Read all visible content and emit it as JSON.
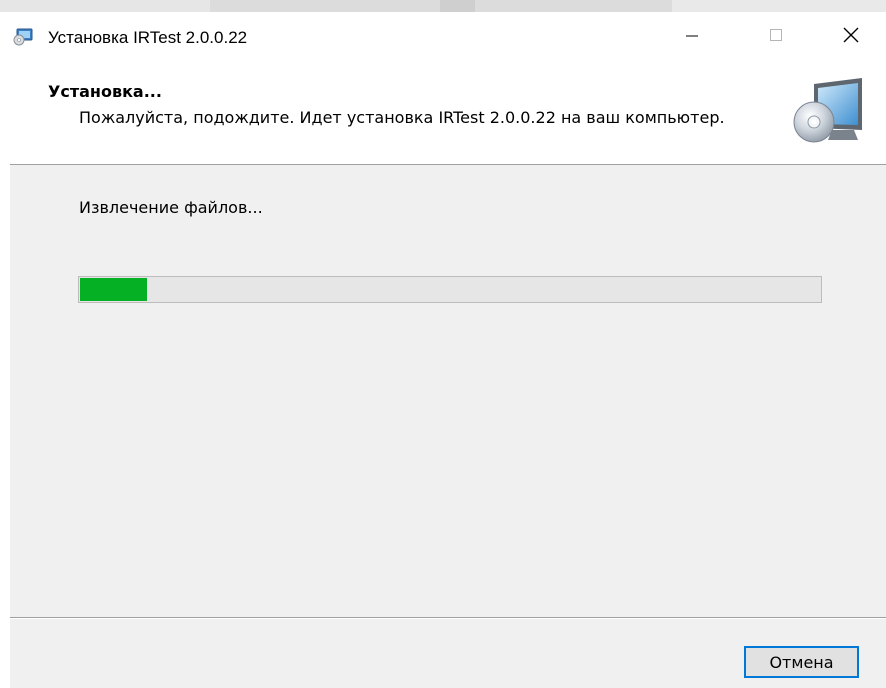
{
  "window": {
    "title": "Установка IRTest 2.0.0.22"
  },
  "header": {
    "title": "Установка...",
    "subtitle": "Пожалуйста, подождите. Идет установка IRTest 2.0.0.22 на ваш компьютер."
  },
  "progress": {
    "status": "Извлечение файлов...",
    "value": 0.09,
    "color": "#06b025"
  },
  "footer": {
    "cancel_label": "Отмена"
  },
  "icons": {
    "app": "installer-icon",
    "header": "cd-monitor-icon",
    "minimize": "minimize-icon",
    "maximize": "maximize-icon",
    "close": "close-icon"
  }
}
